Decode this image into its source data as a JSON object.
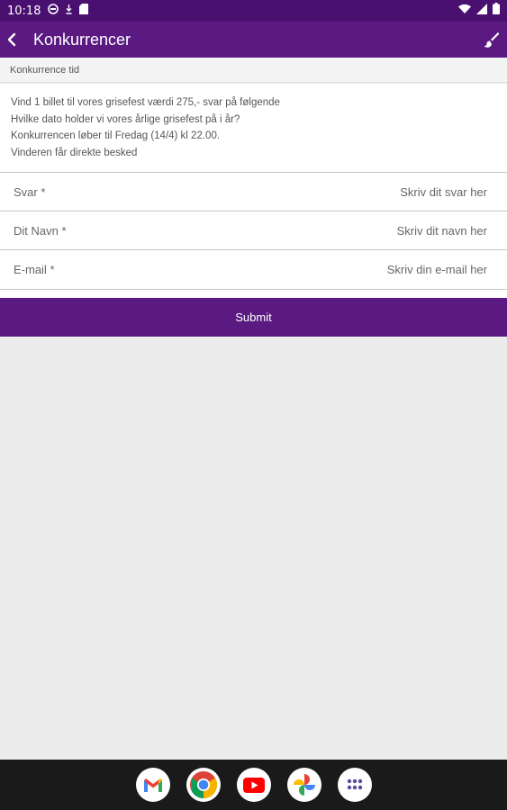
{
  "status_bar": {
    "time": "10:18",
    "icons": [
      "vpn-key-icon",
      "download-icon",
      "sd-card-icon"
    ],
    "right_icons": [
      "wifi-icon",
      "signal-icon",
      "battery-icon"
    ]
  },
  "app_bar": {
    "title": "Konkurrencer",
    "back_icon": "back-arrow-icon",
    "action_icon": "paintbrush-icon",
    "background_color": "#5a1a82"
  },
  "competition": {
    "header": "Konkurrence tid",
    "description_lines": [
      "Vind 1 billet til vores grisefest værdi 275,- svar på følgende",
      "Hvilke dato holder vi vores årlige grisefest på i år?",
      "Konkurrencen løber til Fredag (14/4) kl 22.00.",
      "Vinderen får direkte besked"
    ]
  },
  "form": {
    "fields": [
      {
        "label": "Svar *",
        "value": "",
        "placeholder": "Skriv dit svar her"
      },
      {
        "label": "Dit Navn *",
        "value": "",
        "placeholder": "Skriv dit navn her"
      },
      {
        "label": "E-mail *",
        "value": "",
        "placeholder": "Skriv din e-mail her"
      }
    ],
    "submit_label": "Submit"
  },
  "dock": {
    "apps": [
      "gmail-icon",
      "chrome-icon",
      "youtube-icon",
      "photos-icon",
      "app-drawer-icon"
    ]
  }
}
